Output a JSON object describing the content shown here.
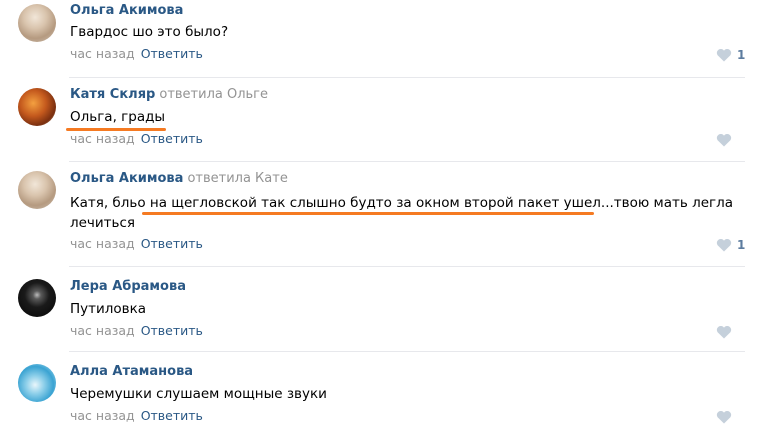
{
  "colors": {
    "link": "#2a5885",
    "meta": "#939393",
    "like": "#5d7c9f",
    "divider": "#e7e8ec",
    "annotation": "#f57a22"
  },
  "comments": [
    {
      "author": "Ольга Акимова",
      "reply_to": "",
      "text": "Гвардос шо это было?",
      "time": "час назад",
      "reply_label": "Ответить",
      "likes": "1",
      "avatar": "woman-photo"
    },
    {
      "author": "Катя Скляр",
      "reply_to": "ответила Ольге",
      "text": "Ольга, грады",
      "time": "час назад",
      "reply_label": "Ответить",
      "likes": "",
      "avatar": "autumn-photo"
    },
    {
      "author": "Ольга Акимова",
      "reply_to": "ответила Кате",
      "text": "Катя, бльо на щегловской так слышно будто за окном второй пакет ушел...твою мать легла лечиться",
      "time": "час назад",
      "reply_label": "Ответить",
      "likes": "1",
      "avatar": "woman-photo"
    },
    {
      "author": "Лера Абрамова",
      "reply_to": "",
      "text": "Путиловка",
      "time": "час назад",
      "reply_label": "Ответить",
      "likes": "",
      "avatar": "dark-photo"
    },
    {
      "author": "Алла Атаманова",
      "reply_to": "",
      "text": "Черемушки слушаем мощные звуки",
      "time": "час назад",
      "reply_label": "Ответить",
      "likes": "",
      "avatar": "sea-photo"
    }
  ]
}
